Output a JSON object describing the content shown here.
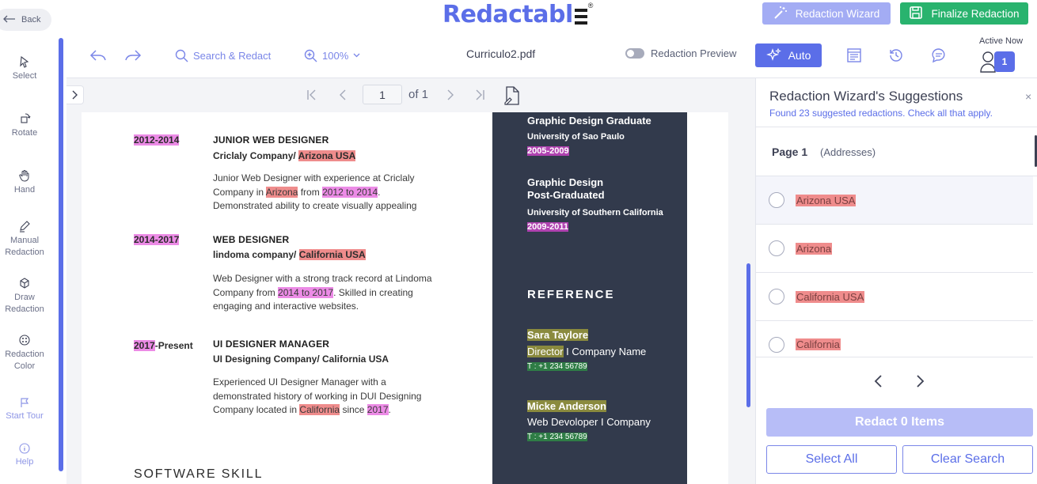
{
  "app": {
    "logo": "Redactabl",
    "logo_reg": "®",
    "back_label": "Back",
    "wizard_button": "Redaction Wizard",
    "finalize_button": "Finalize Redaction"
  },
  "colors": {
    "accent": "#5b6ee8",
    "success": "#29b36e",
    "highlight_red": "#ef8c8c",
    "highlight_pink": "#ec8be6",
    "dark_column": "#323a4c"
  },
  "left_tools": [
    {
      "label": "Select",
      "icon": "cursor-icon"
    },
    {
      "label": "Rotate",
      "icon": "rotate-icon"
    },
    {
      "label": "Hand",
      "icon": "hand-icon"
    },
    {
      "label": "Manual Redaction",
      "icon": "pen-icon"
    },
    {
      "label": "Draw Redaction",
      "icon": "cube-icon"
    },
    {
      "label": "Redaction Color",
      "icon": "palette-icon"
    },
    {
      "label": "Start Tour",
      "icon": "flag-icon"
    },
    {
      "label": "Help",
      "icon": "info-icon"
    }
  ],
  "toolbar": {
    "search_label": "Search & Redact",
    "zoom_label": "100%",
    "file_name": "Curriculo2.pdf",
    "preview_label": "Redaction Preview",
    "auto_label": "Auto",
    "active_now": "Active Now",
    "active_count": "1"
  },
  "pager": {
    "current_page": "1",
    "of_label": "of 1"
  },
  "document": {
    "jobs": [
      {
        "date_hl": "2012-2014",
        "date_rest": "",
        "title": "JUNIOR WEB DESIGNER",
        "company": "Criclaly Company/ ",
        "company_hl": "Arizona USA",
        "line1": "Junior Web Designer with experience at Criclaly",
        "line2a": "Company in ",
        "line2b": "Arizona",
        "line2c": " from ",
        "line2d": "2012 to 2014",
        "line2e": ".",
        "line3": "Demonstrated ability to create visually appealing"
      },
      {
        "date_hl": "2014-2017",
        "date_rest": "",
        "title": "WEB DESIGNER",
        "company": "lindoma company/ ",
        "company_hl": "California USA",
        "line1": "Web Designer with a strong track record at Lindoma",
        "line2a": "Company from ",
        "line2b": "2014 to 2017",
        "line2c": ". Skilled in creating",
        "line3": "engaging and interactive websites."
      },
      {
        "date_hl": "2017",
        "date_rest": "-Present",
        "title": "UI DESIGNER MANAGER",
        "company": "UI Designing Company/ California USA",
        "line1": "Experienced UI Designer Manager with a",
        "line2": "demonstrated history of working in DUI Designing",
        "line3a": "Company located in ",
        "line3b": "California",
        "line3c": " since ",
        "line3d": "2017",
        "line3e": "."
      }
    ],
    "section": "SOFTWARE SKILL",
    "education": [
      {
        "degree": "Graphic Design Graduate",
        "school": "University of Sao Paulo",
        "years": "2005-2009"
      },
      {
        "degree1": "Graphic Design",
        "degree2": "Post-Graduated",
        "school": "University of Southern California",
        "years": "2009-2011"
      }
    ],
    "reference_heading": "REFERENCE",
    "references": [
      {
        "name": "Sara Taylore",
        "role_hl": "Director",
        "role_rest": " I Company Name",
        "tel": "T : +1 234 56789"
      },
      {
        "name": "Micke Anderson",
        "role": "Web Devoloper I Company",
        "tel": "T : +1 234 56789"
      }
    ]
  },
  "panel": {
    "title": "Redaction Wizard's Suggestions",
    "subtitle": "Found 23 suggested redactions. Check all that apply.",
    "close": "×",
    "page_label": "Page 1",
    "category": "(Addresses)",
    "suggestions": [
      "Arizona USA",
      "Arizona",
      "California USA",
      "California"
    ],
    "redact_button": "Redact 0 Items",
    "select_all": "Select All",
    "clear_search": "Clear Search"
  }
}
